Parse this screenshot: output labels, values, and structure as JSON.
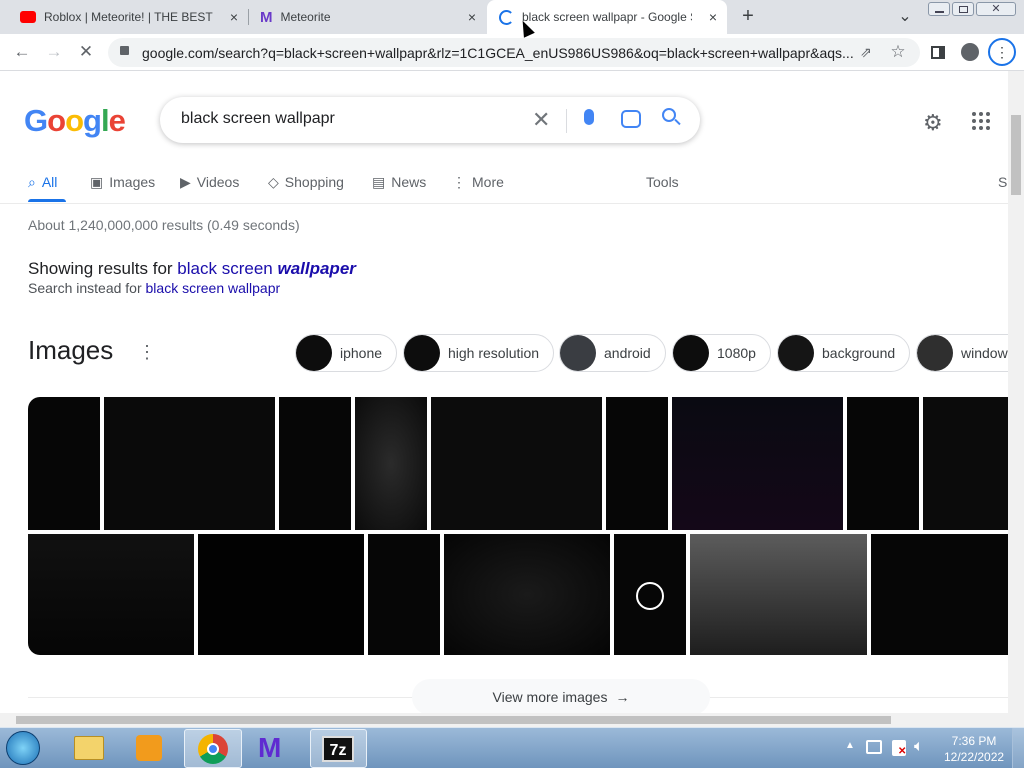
{
  "browser": {
    "tabs": [
      {
        "title": "Roblox | Meteorite! | THE BEST R(",
        "close": "×"
      },
      {
        "title": "Meteorite",
        "close": "×"
      },
      {
        "title": "black screen wallpapr - Google S",
        "close": "×"
      }
    ],
    "new_tab": "+",
    "tab_list": "⌄",
    "url": "google.com/search?q=black+screen+wallpapr&rlz=1C1GCEA_enUS986US986&oq=black+screen+wallpapr&aqs..."
  },
  "google": {
    "query": "black screen wallpapr",
    "nav": [
      "All",
      "Images",
      "Videos",
      "Shopping",
      "News",
      "More"
    ],
    "tools": "Tools",
    "safe_partial": "S",
    "result_stats": "About 1,240,000,000 results (0.49 seconds)",
    "showing_prefix": "Showing results for ",
    "showing_plain": "black screen ",
    "showing_bold": "wallpaper",
    "instead_prefix": "Search instead for ",
    "instead_link": "black screen wallpapr",
    "images_heading": "Images",
    "chips": [
      "iphone",
      "high resolution",
      "android",
      "1080p",
      "background",
      "window"
    ],
    "view_more": "View more images"
  },
  "taskbar": {
    "time": "7:36 PM",
    "date": "12/22/2022",
    "seven_zip": "7z"
  },
  "colors": {
    "link": "#1a0dab",
    "accent": "#1a73e8"
  }
}
